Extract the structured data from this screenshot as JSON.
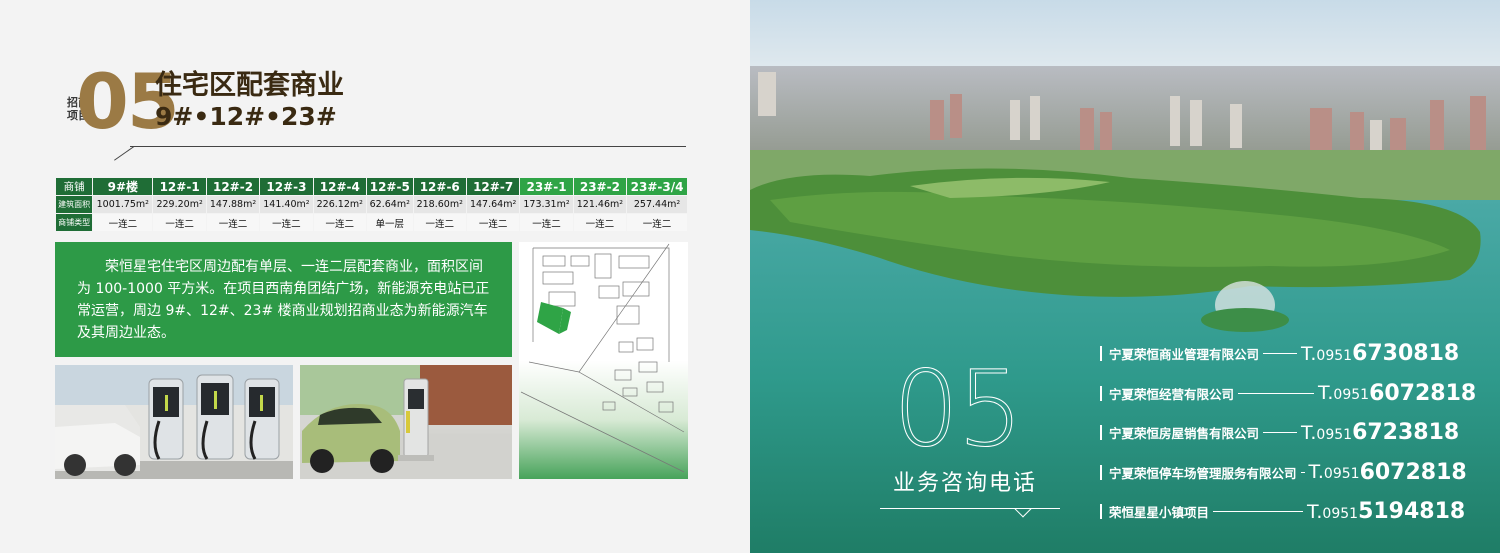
{
  "left": {
    "section_tag": "招商项目",
    "section_number": "05",
    "title": "住宅区配套商业",
    "subtitle": "9#•12#•23#",
    "table": {
      "header": [
        "商铺",
        "9#楼",
        "12#-1",
        "12#-2",
        "12#-3",
        "12#-4",
        "12#-5",
        "12#-6",
        "12#-7",
        "23#-1",
        "23#-2",
        "23#-3/4"
      ],
      "rows": [
        [
          "建筑面积",
          "1001.75m²",
          "229.20m²",
          "147.88m²",
          "141.40m²",
          "226.12m²",
          "62.64m²",
          "218.60m²",
          "147.64m²",
          "173.31m²",
          "121.46m²",
          "257.44m²"
        ],
        [
          "商铺类型",
          "一连二",
          "一连二",
          "一连二",
          "一连二",
          "一连二",
          "单一层",
          "一连二",
          "一连二",
          "一连二",
          "一连二",
          "一连二"
        ]
      ]
    },
    "description": "荣恒星宅住宅区周边配有单层、一连二层配套商业，面积区间为 100-1000 平方米。在项目西南角团结广场，新能源充电站已正常运营，周边 9#、12#、23# 楼商业规划招商业态为新能源汽车及其周边业态。",
    "colors": {
      "dark_green": "#1f6d36",
      "light_green": "#2fa446",
      "gold": "#9b7a45"
    }
  },
  "right": {
    "number": "05",
    "hotline_title": "业务咨询电话",
    "contacts": [
      {
        "company": "宁夏荣恒商业管理有限公司",
        "prefix": "T.",
        "area": "0951",
        "number": "6730818"
      },
      {
        "company": "宁夏荣恒经营有限公司",
        "prefix": "T.",
        "area": "0951",
        "number": "6072818"
      },
      {
        "company": "宁夏荣恒房屋销售有限公司",
        "prefix": "T.",
        "area": "0951",
        "number": "6723818"
      },
      {
        "company": "宁夏荣恒停车场管理服务有限公司",
        "prefix": "T.",
        "area": "0951",
        "number": "6072818"
      },
      {
        "company": "荣恒星星小镇项目",
        "prefix": "T.",
        "area": "0951",
        "number": "5194818"
      }
    ]
  }
}
